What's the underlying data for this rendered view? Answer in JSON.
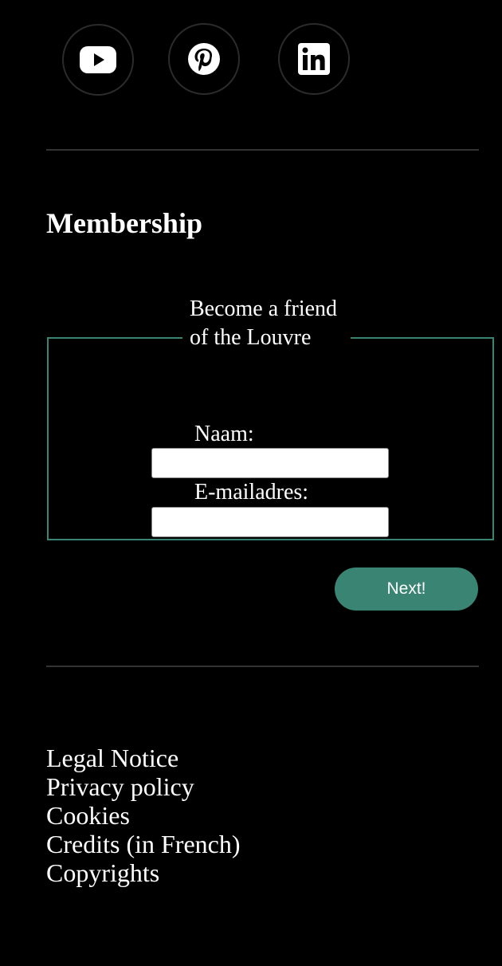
{
  "social": {
    "items": [
      {
        "icon": "youtube-icon",
        "name": "YouTube"
      },
      {
        "icon": "pinterest-icon",
        "name": "Pinterest"
      },
      {
        "icon": "linkedin-icon",
        "name": "LinkedIn"
      }
    ]
  },
  "membership": {
    "title": "Membership",
    "legend": "Become a friend of the Louvre",
    "name_label": "Naam:",
    "name_value": "",
    "email_label": "E-mailadres:",
    "email_value": "",
    "submit_label": "Next!"
  },
  "footer": {
    "links": [
      "Legal Notice",
      "Privacy policy",
      "Cookies",
      "Credits (in French)",
      "Copyrights"
    ]
  },
  "colors": {
    "background": "#000000",
    "accent": "#3a8474",
    "divider": "#333333",
    "text": "#ffffff"
  }
}
